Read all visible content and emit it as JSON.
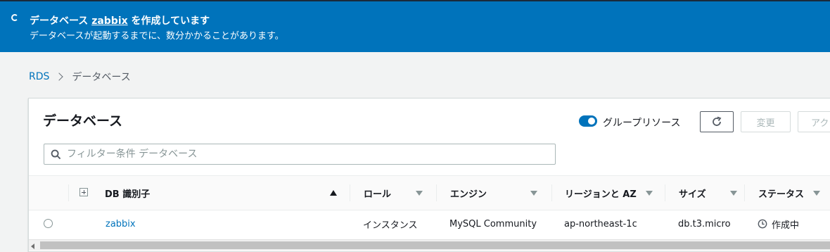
{
  "banner": {
    "title_prefix": "データベース ",
    "title_db": "zabbix",
    "title_suffix": " を作成しています",
    "message": "データベースが起動するまでに、数分かかることがあります。"
  },
  "breadcrumb": {
    "root": "RDS",
    "current": "データベース"
  },
  "panel": {
    "title": "データベース",
    "group_resources_label": "グループリソース",
    "group_resources_on": true,
    "change_button": "変更",
    "action_button": "アクション"
  },
  "search": {
    "placeholder": "フィルター条件 データベース",
    "value": ""
  },
  "table": {
    "columns": {
      "db_id": "DB 識別子",
      "role": "ロール",
      "engine": "エンジン",
      "region": "リージョンと AZ",
      "size": "サイズ",
      "status": "ステータス"
    },
    "rows": [
      {
        "db_id": "zabbix",
        "role": "インスタンス",
        "engine": "MySQL Community",
        "region": "ap-northeast-1c",
        "size": "db.t3.micro",
        "status": "作成中"
      }
    ]
  },
  "colors": {
    "banner_bg": "#0073bb",
    "link": "#0073bb",
    "toggle_on": "#0073bb"
  }
}
